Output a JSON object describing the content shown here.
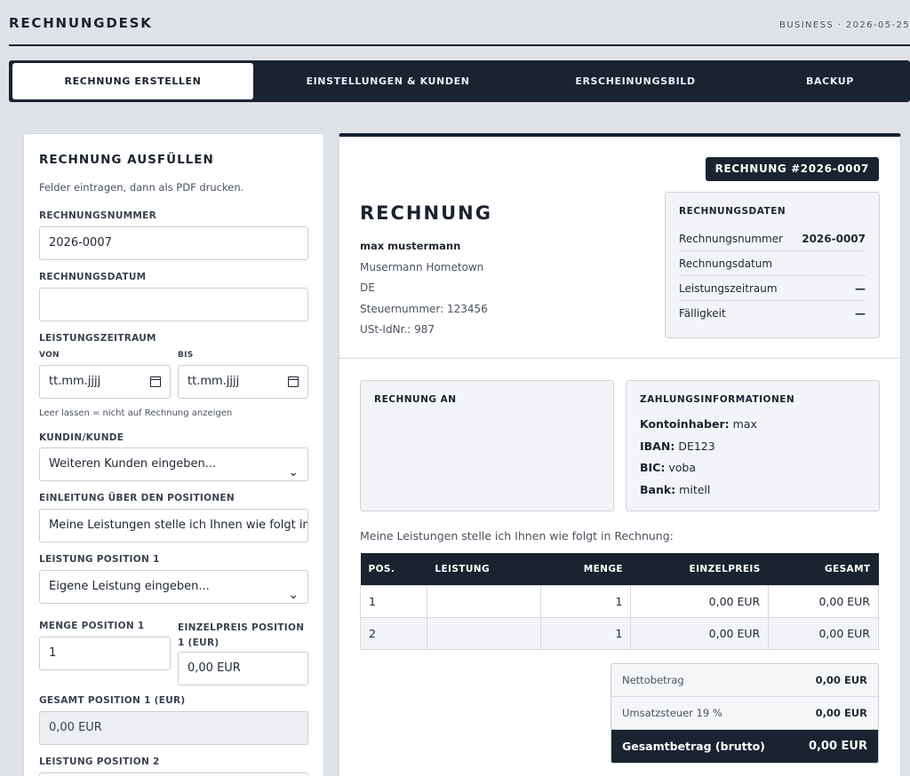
{
  "app": {
    "brand": "RECHNUNGDESK",
    "meta": "BUSINESS · 2026-05-25"
  },
  "tabs": [
    {
      "label": "RECHNUNG ERSTELLEN"
    },
    {
      "label": "EINSTELLUNGEN & KUNDEN"
    },
    {
      "label": "ERSCHEINUNGSBILD"
    },
    {
      "label": "BACKUP"
    }
  ],
  "form": {
    "title": "RECHNUNG AUSFÜLLEN",
    "hint": "Felder eintragen, dann als PDF drucken.",
    "invoice_number_label": "RECHNUNGSNUMMER",
    "invoice_number_value": "2026-0007",
    "invoice_date_label": "RECHNUNGSDATUM",
    "invoice_date_value": "",
    "period_label": "LEISTUNGSZEITRAUM",
    "from_label": "VON",
    "from_value": "tt.mm.jjjj",
    "to_label": "BIS",
    "to_value": "tt.mm.jjjj",
    "period_note": "Leer lassen = nicht auf Rechnung anzeigen",
    "customer_label": "KUNDIN/KUNDE",
    "customer_value": "Weiteren Kunden eingeben...",
    "intro_label": "EINLEITUNG ÜBER DEN POSITIONEN",
    "intro_value": "Meine Leistungen stelle ich Ihnen wie folgt in",
    "service1_label": "LEISTUNG POSITION 1",
    "service1_value": "Eigene Leistung eingeben...",
    "qty1_label": "MENGE POSITION 1",
    "qty1_value": "1",
    "price1_label": "EINZELPREIS POSITION 1 (EUR)",
    "price1_value": "0,00 EUR",
    "total1_label": "GESAMT POSITION 1 (EUR)",
    "total1_value": "0,00 EUR",
    "service2_label": "LEISTUNG POSITION 2"
  },
  "invoice": {
    "badge": "RECHNUNG #2026-0007",
    "title": "RECHNUNG",
    "sender": {
      "name": "max mustermann",
      "line1": "Musermann Hometown",
      "line2": "DE",
      "tax_number": "Steuernummer: 123456",
      "vat_id": "USt-IdNr.: 987"
    },
    "data_box": {
      "title": "RECHNUNGSDATEN",
      "rows": [
        {
          "label": "Rechnungsnummer",
          "value": "2026-0007"
        },
        {
          "label": "Rechnungsdatum",
          "value": ""
        },
        {
          "label": "Leistungszeitraum",
          "value": "—"
        },
        {
          "label": "Fälligkeit",
          "value": "—"
        }
      ]
    },
    "recipient_title": "RECHNUNG AN",
    "payment": {
      "title": "ZAHLUNGSINFORMATIONEN",
      "holder_label": "Kontoinhaber:",
      "holder": "max",
      "iban_label": "IBAN:",
      "iban": "DE123",
      "bic_label": "BIC:",
      "bic": "voba",
      "bank_label": "Bank:",
      "bank": "mitell"
    },
    "intro": "Meine Leistungen stelle ich Ihnen wie folgt in Rechnung:",
    "table": {
      "headers": [
        "POS.",
        "LEISTUNG",
        "MENGE",
        "EINZELPREIS",
        "GESAMT"
      ],
      "rows": [
        [
          "1",
          "",
          "1",
          "0,00 EUR",
          "0,00 EUR"
        ],
        [
          "2",
          "",
          "1",
          "0,00 EUR",
          "0,00 EUR"
        ]
      ]
    },
    "summary": {
      "net_label": "Nettobetrag",
      "net": "0,00 EUR",
      "vat_label": "Umsatzsteuer 19 %",
      "vat": "0,00 EUR",
      "gross_label": "Gesamtbetrag (brutto)",
      "gross": "0,00 EUR"
    }
  }
}
